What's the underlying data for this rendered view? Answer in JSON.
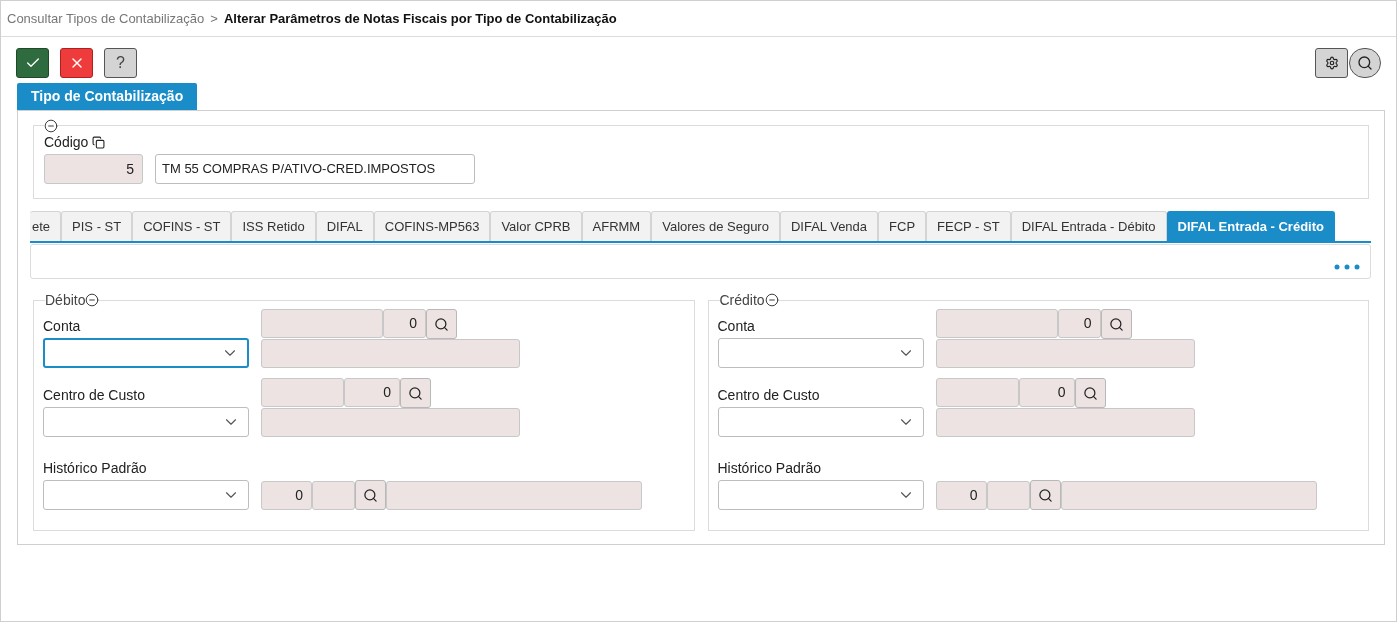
{
  "breadcrumb": {
    "separator": ">",
    "items": [
      {
        "label": "Consultar Tipos de Contabilização",
        "current": false
      },
      {
        "label": "Alterar Parâmetros de Notas Fiscais por Tipo de Contabilização",
        "current": true
      }
    ]
  },
  "toolbar": {
    "left": [
      {
        "kind": "confirm"
      },
      {
        "kind": "cancel"
      },
      {
        "kind": "help",
        "label": "?"
      }
    ],
    "right": [
      {
        "kind": "settings"
      },
      {
        "kind": "search"
      }
    ]
  },
  "section_tab": {
    "label": "Tipo de Contabilização",
    "selected": true
  },
  "codigo": {
    "label": "Código",
    "value": "5",
    "description": "TM 55 COMPRAS P/ATIVO-CRED.IMPOSTOS"
  },
  "tabs": [
    {
      "label": "ete",
      "selected": false
    },
    {
      "label": "PIS - ST",
      "selected": false
    },
    {
      "label": "COFINS - ST",
      "selected": false
    },
    {
      "label": "ISS Retido",
      "selected": false
    },
    {
      "label": "DIFAL",
      "selected": false
    },
    {
      "label": "COFINS-MP563",
      "selected": false
    },
    {
      "label": "Valor CPRB",
      "selected": false
    },
    {
      "label": "AFRMM",
      "selected": false
    },
    {
      "label": "Valores de Seguro",
      "selected": false
    },
    {
      "label": "DIFAL Venda",
      "selected": false
    },
    {
      "label": "FCP",
      "selected": false
    },
    {
      "label": "FECP - ST",
      "selected": false
    },
    {
      "label": "DIFAL Entrada - Débito",
      "selected": false
    },
    {
      "label": "DIFAL Entrada - Crédito",
      "selected": true
    }
  ],
  "groups": [
    {
      "title": "Débito",
      "rows": [
        {
          "label": "Conta",
          "kind": "stacked",
          "focused": true,
          "number": "0"
        },
        {
          "label": "Centro de Custo",
          "kind": "stacked_short",
          "focused": false,
          "number": "0"
        },
        {
          "label": "Histórico Padrão",
          "kind": "inline",
          "focused": false,
          "number": "0"
        }
      ]
    },
    {
      "title": "Crédito",
      "rows": [
        {
          "label": "Conta",
          "kind": "stacked",
          "focused": false,
          "number": "0"
        },
        {
          "label": "Centro de Custo",
          "kind": "stacked_short",
          "focused": false,
          "number": "0"
        },
        {
          "label": "Histórico Padrão",
          "kind": "inline",
          "focused": false,
          "number": "0"
        }
      ]
    }
  ]
}
